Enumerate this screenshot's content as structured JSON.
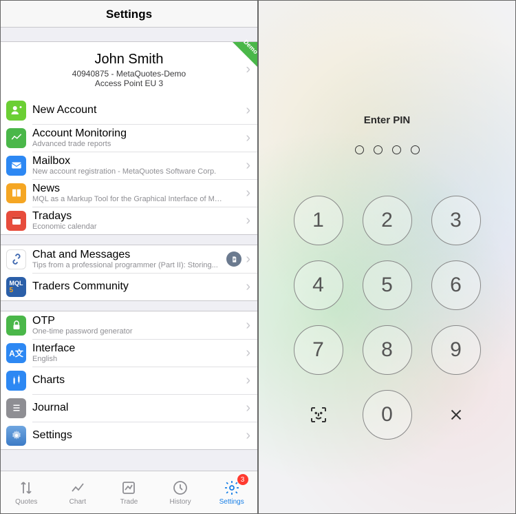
{
  "left": {
    "title": "Settings",
    "account": {
      "demo_label": "Demo",
      "name": "John Smith",
      "id_server": "40940875 - MetaQuotes-Demo",
      "access_point": "Access Point EU 3"
    },
    "group1": [
      {
        "title": "New Account",
        "sub": ""
      },
      {
        "title": "Account Monitoring",
        "sub": "Advanced trade reports"
      },
      {
        "title": "Mailbox",
        "sub": "New account registration - MetaQuotes Software Corp."
      },
      {
        "title": "News",
        "sub": "MQL as a Markup Tool for the Graphical Interface of MQL..."
      },
      {
        "title": "Tradays",
        "sub": "Economic calendar"
      }
    ],
    "group2": [
      {
        "title": "Chat and Messages",
        "sub": "Tips from a professional programmer (Part II): Storing...",
        "badge": true
      },
      {
        "title": "Traders Community",
        "sub": ""
      }
    ],
    "group3": [
      {
        "title": "OTP",
        "sub": "One-time password generator"
      },
      {
        "title": "Interface",
        "sub": "English"
      },
      {
        "title": "Charts",
        "sub": ""
      },
      {
        "title": "Journal",
        "sub": ""
      },
      {
        "title": "Settings",
        "sub": ""
      }
    ],
    "tabs": [
      {
        "label": "Quotes"
      },
      {
        "label": "Chart"
      },
      {
        "label": "Trade"
      },
      {
        "label": "History"
      },
      {
        "label": "Settings",
        "active": true,
        "badge": "3"
      }
    ]
  },
  "right": {
    "title": "Enter PIN",
    "pin_length": 4,
    "keys": [
      "1",
      "2",
      "3",
      "4",
      "5",
      "6",
      "7",
      "8",
      "9",
      "face",
      "0",
      "del"
    ]
  }
}
